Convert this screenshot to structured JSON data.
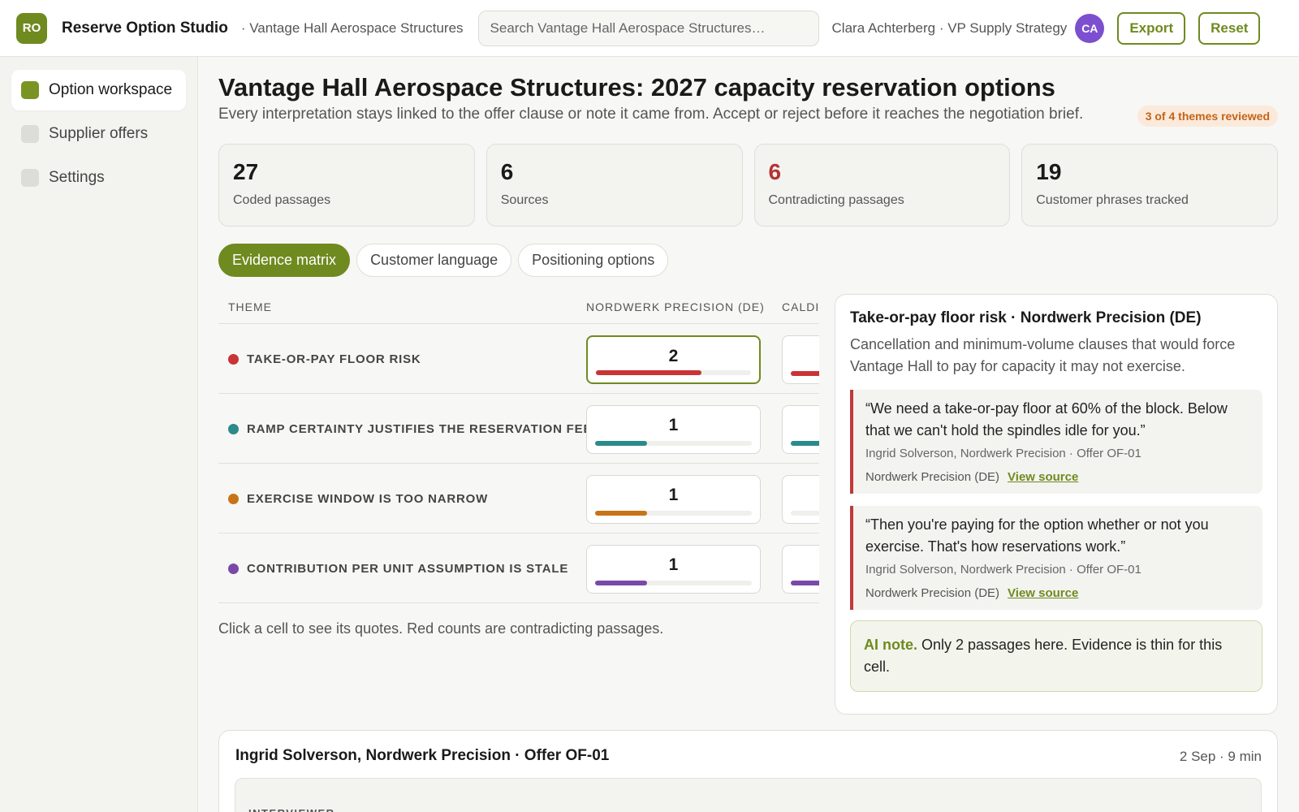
{
  "app": {
    "logo_initials": "RO",
    "title": "Reserve Option Studio",
    "org_crumb": "· Vantage Hall Aerospace Structures"
  },
  "search": {
    "placeholder": "Search Vantage Hall Aerospace Structures…"
  },
  "user": {
    "name": "Clara Achterberg · VP Supply Strategy",
    "initials": "CA"
  },
  "toolbar": {
    "export_label": "Export",
    "reset_label": "Reset"
  },
  "sidebar": {
    "items": [
      {
        "label": "Option workspace",
        "active": true
      },
      {
        "label": "Supplier offers",
        "active": false
      },
      {
        "label": "Settings",
        "active": false
      }
    ]
  },
  "page": {
    "title": "Vantage Hall Aerospace Structures: 2027 capacity reservation options",
    "subtitle": "Every interpretation stays linked to the offer clause or note it came from. Accept or reject before it reaches the negotiation brief.",
    "review_badge": "3 of 4 themes reviewed"
  },
  "stats": [
    {
      "value": "27",
      "label": "Coded passages"
    },
    {
      "value": "6",
      "label": "Sources"
    },
    {
      "value": "6",
      "label": "Contradicting passages"
    },
    {
      "value": "19",
      "label": "Customer phrases tracked"
    }
  ],
  "tabs": [
    {
      "label": "Evidence matrix",
      "active": true
    },
    {
      "label": "Customer language",
      "active": false
    },
    {
      "label": "Positioning options",
      "active": false
    }
  ],
  "matrix": {
    "col_theme": "Theme",
    "col_1": "Nordwerk Precision (DE)",
    "col_2": "Caldi",
    "rows": [
      {
        "theme": "Take-or-pay floor risk",
        "color": "#c93434",
        "count_1": "2",
        "fill_1": 0.68,
        "fill_2": 1.0
      },
      {
        "theme": "Ramp certainty justifies the reservation fee",
        "color": "#2b8a8a",
        "count_1": "1",
        "fill_1": 0.33,
        "fill_2": 1.0
      },
      {
        "theme": "Exercise window is too narrow",
        "color": "#c77418",
        "count_1": "1",
        "fill_1": 0.33,
        "fill_2": 0.0
      },
      {
        "theme": "Contribution per unit assumption is stale",
        "color": "#7a49a8",
        "count_1": "1",
        "fill_1": 0.33,
        "fill_2": 1.0
      }
    ],
    "hint": "Click a cell to see its quotes. Red counts are contradicting passages."
  },
  "detail": {
    "title": "Take-or-pay floor risk · Nordwerk Precision (DE)",
    "description": "Cancellation and minimum-volume clauses that would force Vantage Hall to pay for capacity it may not exercise.",
    "quotes": [
      {
        "text": "“We need a take-or-pay floor at 60% of the block. Below that we can't hold the spindles idle for you.”",
        "meta": "Ingrid Solverson, Nordwerk Precision · Offer OF-01",
        "source": "Nordwerk Precision (DE)",
        "link": "View source"
      },
      {
        "text": "“Then you're paying for the option whether or not you exercise. That's how reservations work.”",
        "meta": "Ingrid Solverson, Nordwerk Precision · Offer OF-01",
        "source": "Nordwerk Precision (DE)",
        "link": "View source"
      }
    ],
    "ai_note_label": "AI note.",
    "ai_note_text": " Only 2 passages here. Evidence is thin for this cell."
  },
  "transcript": {
    "title": "Ingrid Solverson, Nordwerk Precision · Offer OF-01",
    "meta": "2 Sep · 9 min",
    "role": "Interviewer"
  },
  "colors": {
    "accent": "#6f8a1f",
    "contradict": "#b53333",
    "avatar": "#7c4fd0"
  }
}
